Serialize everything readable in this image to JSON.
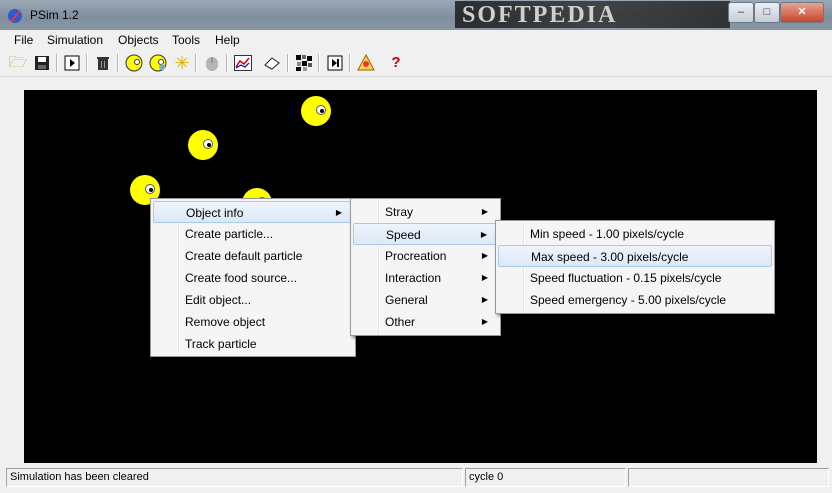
{
  "window": {
    "title": "PSim 1.2",
    "watermark": "SOFTPEDIA",
    "minimize": "–",
    "maximize": "□",
    "close": "✕"
  },
  "menubar": [
    "File",
    "Simulation",
    "Objects",
    "Tools",
    "Help"
  ],
  "toolbar": {
    "icons": [
      "open-folder-icon",
      "save-icon",
      "run-icon",
      "delete-icon",
      "particle-icon",
      "default-particle-icon",
      "food-source-icon",
      "mouse-icon",
      "chart-icon",
      "eraser-icon",
      "grid-icon",
      "step-icon",
      "info-icon",
      "help-icon"
    ]
  },
  "context_menu": {
    "items": [
      "Object info",
      "Create particle...",
      "Create default particle",
      "Create food source...",
      "Edit object...",
      "Remove object",
      "Track particle"
    ]
  },
  "submenu_object_info": {
    "items": [
      "Stray",
      "Speed",
      "Procreation",
      "Interaction",
      "General",
      "Other"
    ]
  },
  "submenu_speed": {
    "items": [
      "Min speed - 1.00 pixels/cycle",
      "Max speed - 3.00 pixels/cycle",
      "Speed fluctuation - 0.15 pixels/cycle",
      "Speed emergency - 5.00 pixels/cycle"
    ]
  },
  "status": {
    "message": "Simulation has been cleared",
    "cycle": "cycle 0"
  },
  "colors": {
    "canvas": "#000000",
    "particle": "#ffff00",
    "highlight": "#dce9f8"
  }
}
